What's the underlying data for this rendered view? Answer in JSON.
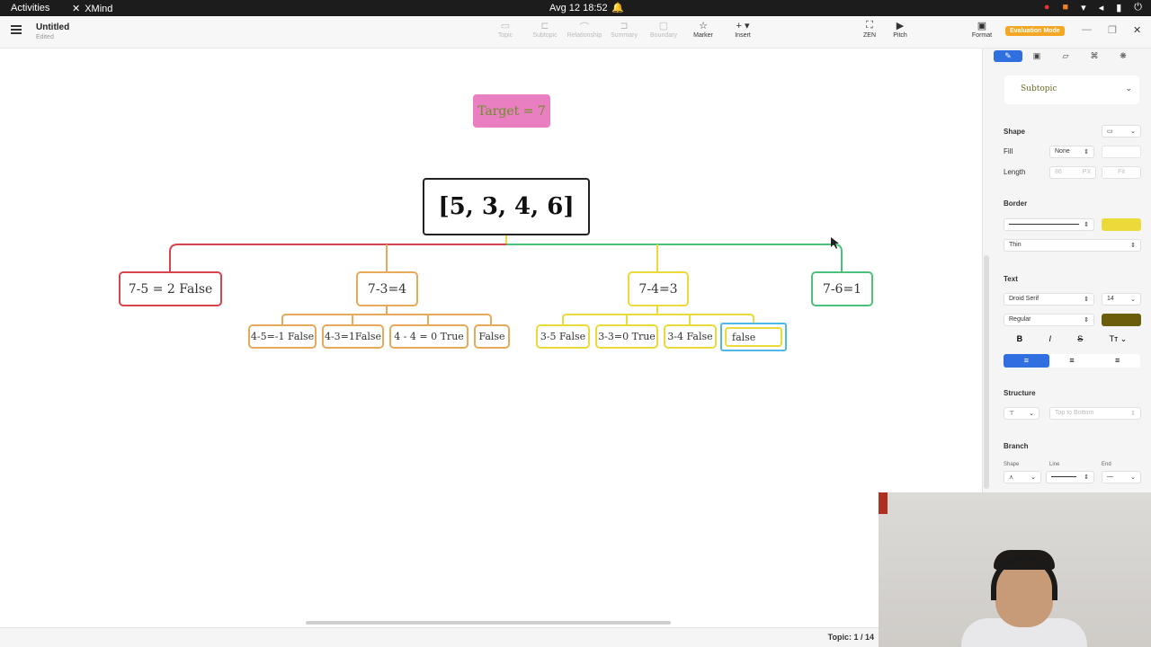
{
  "system_bar": {
    "activities": "Activities",
    "app_name": "XMind",
    "clock": "Avg 12  18:52"
  },
  "toolbar": {
    "doc_title": "Untitled",
    "doc_status": "Edited",
    "tools": [
      "Topic",
      "Subtopic",
      "Relationship",
      "Summary",
      "Boundary",
      "Marker",
      "Insert"
    ],
    "right_tools": [
      "ZEN",
      "Pitch"
    ],
    "format": "Format",
    "eval_badge": "Evaluation Mode"
  },
  "mindmap": {
    "floating": "Target = 7",
    "root": "[5, 3, 4, 6]",
    "branches": [
      {
        "label": "7-5 = 2 False",
        "color": "#d9434b",
        "children": []
      },
      {
        "label": "7-3=4",
        "color": "#e8a95a",
        "children": [
          "4-5=-1 False",
          "4-3=1False",
          "4 - 4 = 0 True",
          "False"
        ]
      },
      {
        "label": "7-4=3",
        "color": "#ecd93a",
        "children": [
          "3-5 False",
          "3-3=0 True",
          "3-4 False",
          "false"
        ]
      },
      {
        "label": "7-6=1",
        "color": "#4cc17c",
        "children": []
      }
    ]
  },
  "status": {
    "topic_count": "Topic: 1 / 14"
  },
  "panel": {
    "style_name": "Subtopic",
    "shape_label": "Shape",
    "fill_label": "Fill",
    "fill_value": "None",
    "length_label": "Length",
    "length_value": "86",
    "length_unit": "PX",
    "fit_label": "Fit",
    "border_label": "Border",
    "border_color": "#ecd93a",
    "border_weight": "Thin",
    "text_label": "Text",
    "font_family": "Droid Serif",
    "font_size": "14",
    "font_weight": "Regular",
    "text_color": "#6b5e0b",
    "structure_label": "Structure",
    "structure_value": "Top to Bottom",
    "branch_label": "Branch",
    "branch_shape": "Shape",
    "branch_line": "Line",
    "branch_end": "End"
  }
}
